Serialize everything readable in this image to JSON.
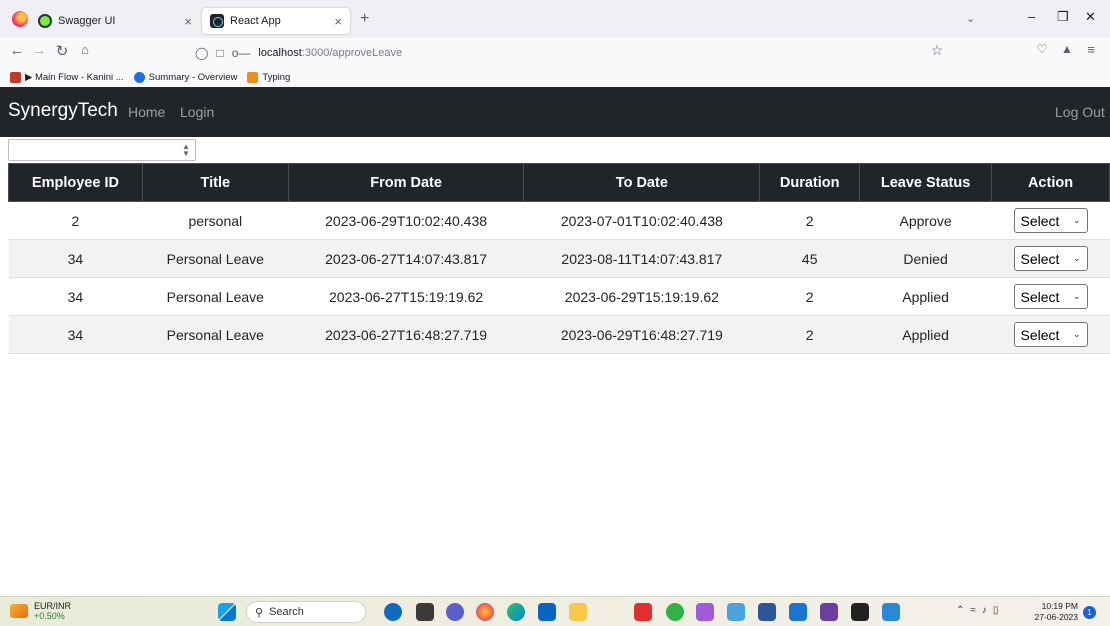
{
  "browser": {
    "tabs": [
      {
        "title": "Swagger UI",
        "active": false,
        "close": "×"
      },
      {
        "title": "React App",
        "active": true,
        "close": "×"
      }
    ],
    "new_tab": "+",
    "url": {
      "host": "localhost",
      "path": ":3000/approveLeave"
    },
    "bookmarks": [
      {
        "label": "▶ Main Flow - Kanini ...",
        "color": "#c0392b"
      },
      {
        "label": "Summary - Overview",
        "color": "#1f6feb"
      },
      {
        "label": "Typing",
        "color": "#f28c1a"
      }
    ]
  },
  "app": {
    "brand": "SynergyTech",
    "nav": {
      "home": "Home",
      "login": "Login",
      "logout": "Log Out"
    },
    "filter": {
      "value": ""
    },
    "table": {
      "headers": [
        "Employee ID",
        "Title",
        "From Date",
        "To Date",
        "Duration",
        "Leave Status",
        "Action"
      ],
      "rows": [
        {
          "employee_id": "2",
          "title": "personal",
          "from_date": "2023-06-29T10:02:40.438",
          "to_date": "2023-07-01T10:02:40.438",
          "duration": "2",
          "status": "Approve",
          "action": "Select"
        },
        {
          "employee_id": "34",
          "title": "Personal Leave",
          "from_date": "2023-06-27T14:07:43.817",
          "to_date": "2023-08-11T14:07:43.817",
          "duration": "45",
          "status": "Denied",
          "action": "Select"
        },
        {
          "employee_id": "34",
          "title": "Personal Leave",
          "from_date": "2023-06-27T15:19:19.62",
          "to_date": "2023-06-29T15:19:19.62",
          "duration": "2",
          "status": "Applied",
          "action": "Select"
        },
        {
          "employee_id": "34",
          "title": "Personal Leave",
          "from_date": "2023-06-27T16:48:27.719",
          "to_date": "2023-06-29T16:48:27.719",
          "duration": "2",
          "status": "Applied",
          "action": "Select"
        }
      ]
    }
  },
  "taskbar": {
    "widget": {
      "symbol": "EUR/INR",
      "change": "+0.50%"
    },
    "search_label": "Search",
    "time": "10:19 PM",
    "date": "27-06-2023",
    "notifications": "1"
  },
  "colors": {
    "navbar": "#212529",
    "table_header": "#212529",
    "stripe": "#f2f2f2"
  }
}
